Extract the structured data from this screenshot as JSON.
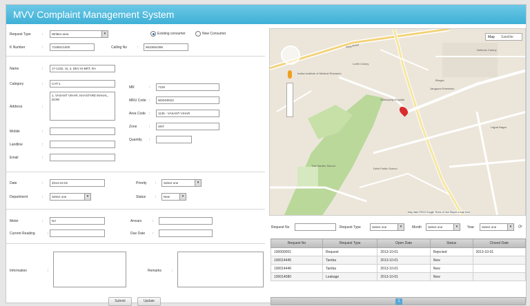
{
  "app": {
    "title": "MVV Complaint Management System"
  },
  "form": {
    "request_type_label": "Request Type",
    "request_type_value": "Written area",
    "existing_consumer_label": "Existing consumer",
    "new_consumer_label": "New Consumer",
    "kno_label": "K Number",
    "kno_value": "710801/1000",
    "calling_no_label": "Calling No",
    "calling_no_value": "9810654396",
    "name_label": "Name",
    "name_value": "17-1332, XL 3, DEV KI-BRT, RA",
    "category_label": "Category",
    "category_value": "CAT-1",
    "address_label": "Address",
    "address_value": "1, VASANT VIHAR, KHASTARE MAHAL, DORI",
    "mobile_label": "Mobile",
    "landline_label": "Landline",
    "email_label": "Email",
    "mr_label": "MR",
    "mr_value": "7100",
    "mru_code_label": "MRU Code",
    "mru_code_value": "NDDS0023",
    "area_code_label": "Area Code",
    "area_code_value": "1135 - VASANT VIHAR",
    "zone_label": "Zone",
    "zone_value": "SNT",
    "quantity_label": "Quantity",
    "date_label": "Date",
    "date_value": "2013-10-02",
    "priority_label": "Priority",
    "priority_value": "Select one",
    "department_label": "Department",
    "department_value": "Select one",
    "status_label": "Status",
    "status_value": "New",
    "meter_label": "Meter",
    "meter_value": "NA",
    "current_reading_label": "Current Reading",
    "arrears_label": "Arrears",
    "due_date_label": "Due Date",
    "information_label": "Information",
    "remarks_label": "Remarks",
    "submit_label": "Submit",
    "update_label": "Update"
  },
  "map": {
    "map_label": "Map",
    "satellite_label": "Satellite",
    "road_label": "Ring Road",
    "places": [
      "Indian Institute of Medical Research",
      "Lodhi Colony",
      "Safdarjung Hospital",
      "Bhogal",
      "Jangpura Extension",
      "Defence Colony",
      "The Garden School",
      "Delhi Public School",
      "Lajpat Nagar"
    ],
    "footer": "Map data ©2013 Google  Terms of Use  Report a map error"
  },
  "filters": {
    "request_no_label": "Request No",
    "request_type_label": "Request Type",
    "request_type_value": "Select one",
    "month_label": "Month",
    "month_value": "Select one",
    "year_label": "Year",
    "year_value": "Select one"
  },
  "table": {
    "headers": [
      "Request No",
      "Request Type",
      "Open Date",
      "Status",
      "Closed Date"
    ],
    "rows": [
      [
        "100000001",
        "Request",
        "2013-10-01",
        "Rejected",
        "2013-10-01"
      ],
      [
        "100014445",
        "Tamba",
        "2013-10-01",
        "New",
        ""
      ],
      [
        "100014446",
        "Tamba",
        "2013-10-01",
        "New",
        ""
      ],
      [
        "100014080",
        "Leakage",
        "2013-10-01",
        "New",
        ""
      ]
    ],
    "page": "1"
  }
}
